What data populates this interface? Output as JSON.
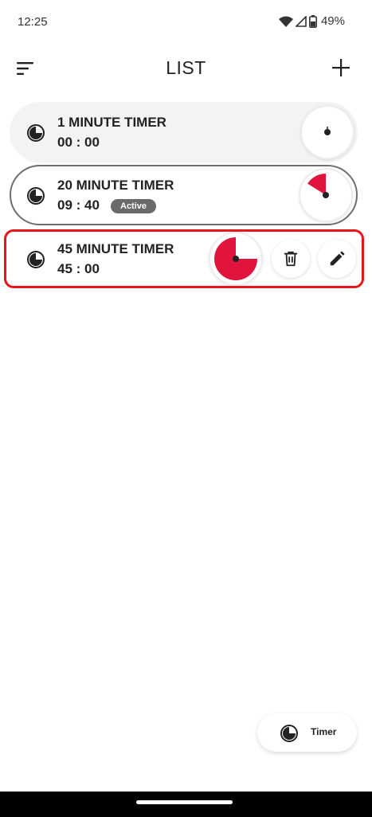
{
  "status_bar": {
    "time": "12:25",
    "battery_percent": "49%",
    "icons": [
      "wifi-icon",
      "signal-icon",
      "battery-icon"
    ]
  },
  "app_bar": {
    "title": "LIST",
    "icons": [
      "menu-icon",
      "add-icon"
    ]
  },
  "timers": [
    {
      "title": "1 MINUTE TIMER",
      "time": "00 : 00",
      "active": false,
      "dial_fraction": 0,
      "icon": "timer-icon"
    },
    {
      "title": "20 MINUTE TIMER",
      "time": "09 : 40",
      "active": true,
      "badge": "Active",
      "dial_fraction": 0.161,
      "icon": "timer-icon"
    },
    {
      "title": "45 MINUTE TIMER",
      "time": "45 : 00",
      "active": false,
      "dial_fraction": 0.75,
      "icon": "timer-icon",
      "actions": [
        "trash-icon",
        "pencil-icon"
      ]
    }
  ],
  "fab": {
    "label": "Timer",
    "icon": "timer-icon"
  },
  "colors": {
    "accent": "#e0143c",
    "highlight_border": "#e8141c",
    "active_badge": "#6a6a6a"
  }
}
